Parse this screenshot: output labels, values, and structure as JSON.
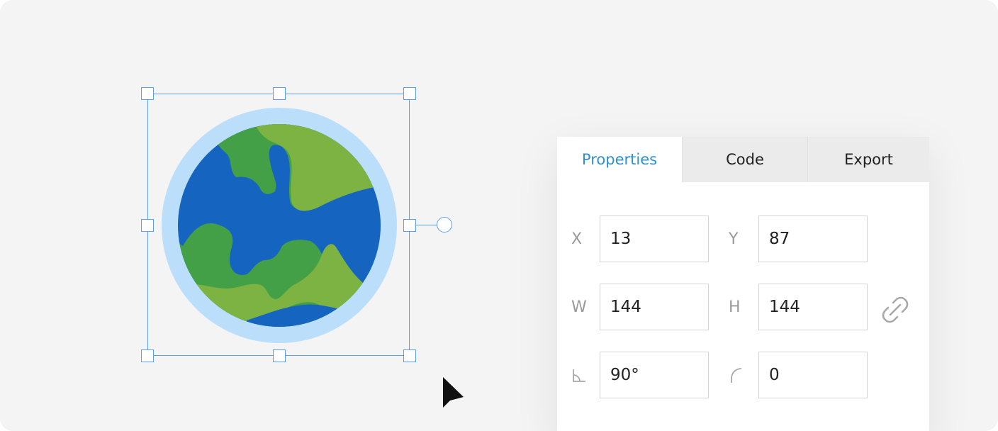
{
  "panel": {
    "tabs": [
      {
        "label": "Properties",
        "active": true
      },
      {
        "label": "Code",
        "active": false
      },
      {
        "label": "Export",
        "active": false
      }
    ],
    "fields": {
      "x": {
        "label": "X",
        "value": "13"
      },
      "y": {
        "label": "Y",
        "value": "87"
      },
      "w": {
        "label": "W",
        "value": "144"
      },
      "h": {
        "label": "H",
        "value": "144"
      },
      "rotation": {
        "icon": "angle-icon",
        "value": "90°"
      },
      "radius": {
        "icon": "corner-radius-icon",
        "value": "0"
      }
    },
    "link_icon": "unlink-icon"
  },
  "canvas": {
    "object_icon": "globe-icon",
    "cursor_icon": "pointer-cursor-icon"
  },
  "colors": {
    "accent": "#2f8fd3",
    "selection": "#5aa0ee",
    "ocean": "#1565c0",
    "land_dark": "#43a047",
    "land_light": "#7cb342",
    "atmosphere": "#bbdefb"
  }
}
